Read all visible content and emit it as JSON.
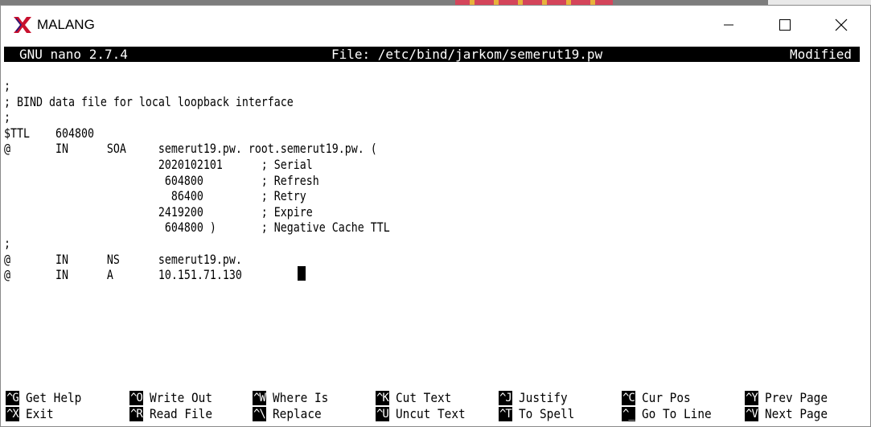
{
  "window": {
    "title": "MALANG",
    "accent_icon_color": "#c8102e"
  },
  "nano": {
    "version": "GNU nano 2.7.4",
    "file": "File: /etc/bind/jarkom/semerut19.pw",
    "status": "Modified"
  },
  "editor": {
    "lines": [
      ";",
      "; BIND data file for local loopback interface",
      ";",
      "$TTL    604800",
      "@       IN      SOA     semerut19.pw. root.semerut19.pw. (",
      "                        2020102101      ; Serial",
      "                         604800         ; Refresh",
      "                          86400         ; Retry",
      "                        2419200         ; Expire",
      "                         604800 )       ; Negative Cache TTL",
      ";",
      "@       IN      NS      semerut19.pw.",
      "@       IN      A       10.151.71.130"
    ]
  },
  "shortcuts": [
    {
      "key": "^G",
      "label": "Get Help"
    },
    {
      "key": "^X",
      "label": "Exit"
    },
    {
      "key": "^O",
      "label": "Write Out"
    },
    {
      "key": "^R",
      "label": "Read File"
    },
    {
      "key": "^W",
      "label": "Where Is"
    },
    {
      "key": "^\\",
      "label": "Replace"
    },
    {
      "key": "^K",
      "label": "Cut Text"
    },
    {
      "key": "^U",
      "label": "Uncut Text"
    },
    {
      "key": "^J",
      "label": "Justify"
    },
    {
      "key": "^T",
      "label": "To Spell"
    },
    {
      "key": "^C",
      "label": "Cur Pos"
    },
    {
      "key": "^_",
      "label": "Go To Line"
    },
    {
      "key": "^Y",
      "label": "Prev Page"
    },
    {
      "key": "^V",
      "label": "Next Page"
    }
  ]
}
